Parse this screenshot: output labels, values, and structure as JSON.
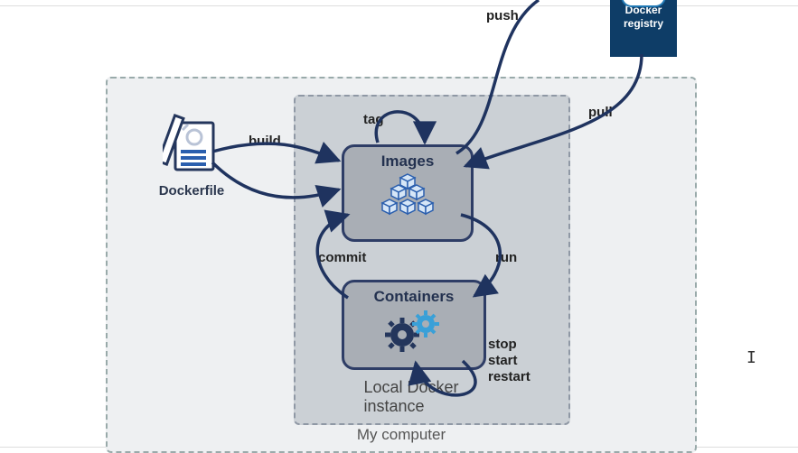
{
  "diagram": {
    "outer_title": "My computer",
    "inner_title": "Local Docker instance"
  },
  "nodes": {
    "dockerfile": "Dockerfile",
    "images": "Images",
    "containers": "Containers",
    "registry_line1": "Docker",
    "registry_line2": "registry"
  },
  "edges": {
    "build": "build",
    "tag": "tag",
    "push": "push",
    "pull": "pull",
    "run": "run",
    "commit": "commit",
    "stop": "stop",
    "start": "start",
    "restart": "restart"
  },
  "colors": {
    "arrow": "#1f335f",
    "box": "#2e3d66"
  }
}
